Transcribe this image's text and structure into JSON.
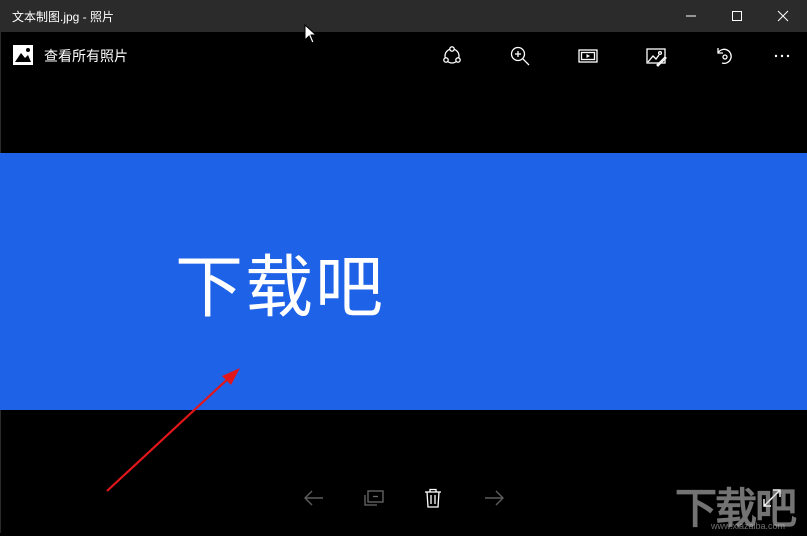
{
  "window": {
    "title": "文本制图.jpg - 照片",
    "controls": {
      "minimize": "minimize-icon",
      "maximize": "maximize-icon",
      "close": "close-icon"
    }
  },
  "appbar": {
    "home_label": "查看所有照片",
    "tools": [
      {
        "name": "share",
        "icon": "share-icon"
      },
      {
        "name": "zoom",
        "icon": "zoom-in-icon"
      },
      {
        "name": "slideshow",
        "icon": "slideshow-icon"
      },
      {
        "name": "edit",
        "icon": "edit-image-icon"
      },
      {
        "name": "rotate",
        "icon": "rotate-icon"
      },
      {
        "name": "more",
        "icon": "more-icon"
      }
    ]
  },
  "photo": {
    "background": "#1e62e8",
    "text": "下载吧"
  },
  "bottombar": {
    "tools": [
      "previous-icon",
      "add-to-album-icon",
      "delete-icon",
      "next-icon",
      "fullscreen-icon"
    ]
  },
  "watermark": {
    "text": "下载吧",
    "url": "www.xiazaiba.com"
  },
  "annotation": {
    "arrow_color": "#e0161b"
  }
}
